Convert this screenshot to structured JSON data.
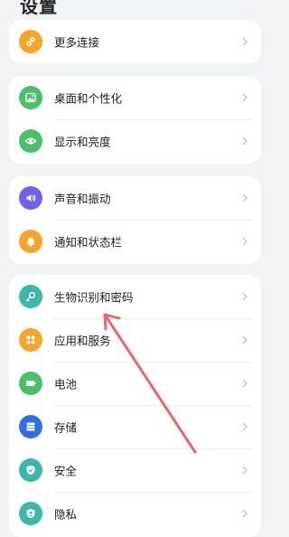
{
  "page": {
    "title": "设置"
  },
  "groups": [
    {
      "items": [
        {
          "label": "更多连接",
          "icon": "link-icon",
          "color": "#f4a52a"
        }
      ]
    },
    {
      "items": [
        {
          "label": "桌面和个性化",
          "icon": "wallpaper-icon",
          "color": "#4bbf6b"
        },
        {
          "label": "显示和亮度",
          "icon": "eye-icon",
          "color": "#4bbf6b"
        }
      ]
    },
    {
      "items": [
        {
          "label": "声音和振动",
          "icon": "sound-icon",
          "color": "#6e62e8"
        },
        {
          "label": "通知和状态栏",
          "icon": "bell-icon",
          "color": "#f4a52a"
        }
      ]
    },
    {
      "items": [
        {
          "label": "生物识别和密码",
          "icon": "key-icon",
          "color": "#3cb7a8"
        },
        {
          "label": "应用和服务",
          "icon": "apps-icon",
          "color": "#f4a52a"
        },
        {
          "label": "电池",
          "icon": "battery-icon",
          "color": "#4bbf6b"
        },
        {
          "label": "存储",
          "icon": "storage-icon",
          "color": "#2f6fe0"
        },
        {
          "label": "安全",
          "icon": "shield-icon",
          "color": "#3cb7a8"
        },
        {
          "label": "隐私",
          "icon": "privacy-icon",
          "color": "#3cb7a8"
        }
      ]
    }
  ],
  "annotation": {
    "color": "#e8686b"
  },
  "chevron_color": "#c4c4c4"
}
